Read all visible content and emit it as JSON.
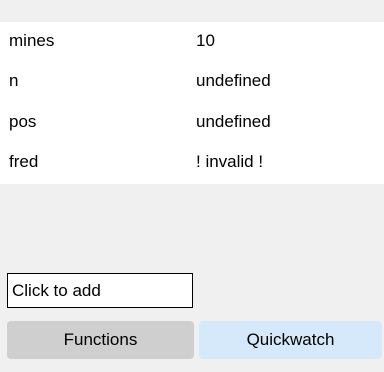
{
  "watch": {
    "rows": [
      {
        "name": "mines",
        "value": "10"
      },
      {
        "name": "n",
        "value": "undefined"
      },
      {
        "name": "pos",
        "value": "undefined"
      },
      {
        "name": "fred",
        "value": "! invalid !"
      }
    ],
    "add_placeholder": "Click to add",
    "add_value": ""
  },
  "tabs": {
    "functions_label": "Functions",
    "quickwatch_label": "Quickwatch"
  },
  "colors": {
    "panel_bg": "#f0f0f0",
    "table_bg": "#ffffff",
    "functions_tab_bg": "#cfcfcf",
    "quickwatch_tab_bg": "#d6e9fb"
  }
}
